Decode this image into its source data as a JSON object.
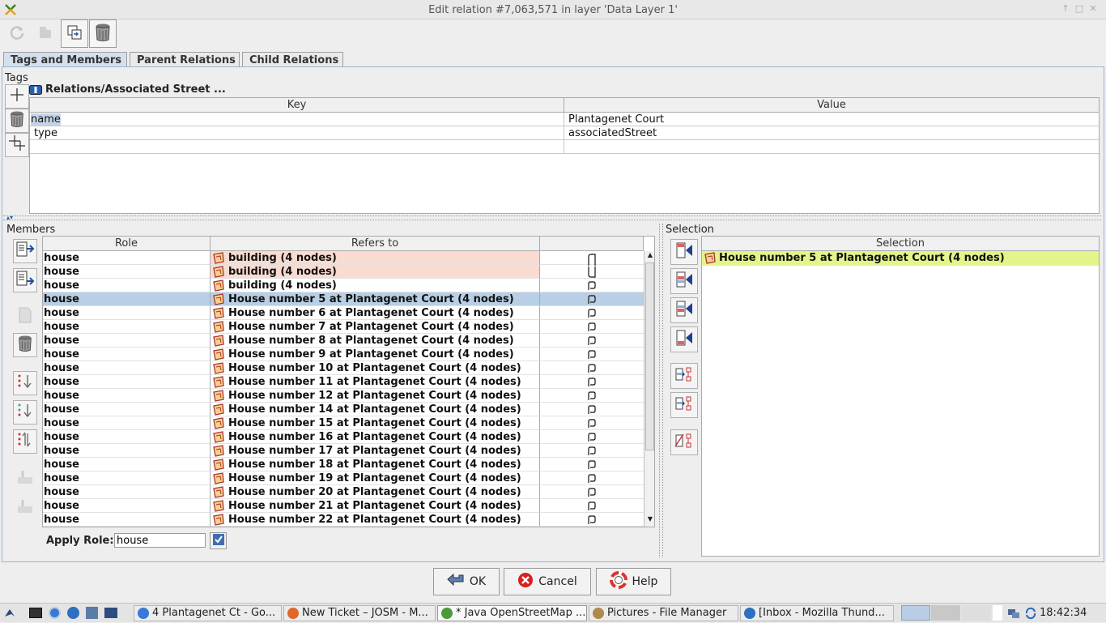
{
  "window": {
    "title": "Edit relation #7,063,571 in layer 'Data Layer 1'"
  },
  "toolbar": {
    "buttons": [
      "refresh-icon",
      "apply-icon",
      "duplicate-icon",
      "delete-icon"
    ]
  },
  "tabs": [
    {
      "label": "Tags and Members",
      "selected": true
    },
    {
      "label": "Parent Relations",
      "selected": false
    },
    {
      "label": "Child Relations",
      "selected": false
    }
  ],
  "tags": {
    "section_label": "Tags",
    "preset_label": "Relations/Associated Street ...",
    "columns": [
      "Key",
      "Value"
    ],
    "rows": [
      {
        "key": "name",
        "value": "Plantagenet Court"
      },
      {
        "key": "type",
        "value": "associatedStreet"
      }
    ]
  },
  "members": {
    "section_label": "Members",
    "columns": [
      "Role",
      "Refers to",
      ""
    ],
    "rows": [
      {
        "role": "house",
        "refers_to": "building (4 nodes)",
        "state": "warn"
      },
      {
        "role": "house",
        "refers_to": "building (4 nodes)",
        "state": "warn"
      },
      {
        "role": "house",
        "refers_to": "building (4 nodes)",
        "state": ""
      },
      {
        "role": "house",
        "refers_to": "House number 5 at Plantagenet Court (4 nodes)",
        "state": "selected"
      },
      {
        "role": "house",
        "refers_to": "House number 6 at Plantagenet Court (4 nodes)",
        "state": ""
      },
      {
        "role": "house",
        "refers_to": "House number 7 at Plantagenet Court (4 nodes)",
        "state": ""
      },
      {
        "role": "house",
        "refers_to": "House number 8 at Plantagenet Court (4 nodes)",
        "state": ""
      },
      {
        "role": "house",
        "refers_to": "House number 9 at Plantagenet Court (4 nodes)",
        "state": ""
      },
      {
        "role": "house",
        "refers_to": "House number 10 at Plantagenet Court (4 nodes)",
        "state": ""
      },
      {
        "role": "house",
        "refers_to": "House number 11 at Plantagenet Court (4 nodes)",
        "state": ""
      },
      {
        "role": "house",
        "refers_to": "House number 12 at Plantagenet Court (4 nodes)",
        "state": ""
      },
      {
        "role": "house",
        "refers_to": "House number 14 at Plantagenet Court (4 nodes)",
        "state": ""
      },
      {
        "role": "house",
        "refers_to": "House number 15 at Plantagenet Court (4 nodes)",
        "state": ""
      },
      {
        "role": "house",
        "refers_to": "House number 16 at Plantagenet Court (4 nodes)",
        "state": ""
      },
      {
        "role": "house",
        "refers_to": "House number 17 at Plantagenet Court (4 nodes)",
        "state": ""
      },
      {
        "role": "house",
        "refers_to": "House number 18 at Plantagenet Court (4 nodes)",
        "state": ""
      },
      {
        "role": "house",
        "refers_to": "House number 19 at Plantagenet Court (4 nodes)",
        "state": ""
      },
      {
        "role": "house",
        "refers_to": "House number 20 at Plantagenet Court (4 nodes)",
        "state": ""
      },
      {
        "role": "house",
        "refers_to": "House number 21 at Plantagenet Court (4 nodes)",
        "state": ""
      },
      {
        "role": "house",
        "refers_to": "House number 22 at Plantagenet Court (4 nodes)",
        "state": ""
      }
    ],
    "apply_role_label": "Apply Role:",
    "apply_role_value": "house"
  },
  "selection": {
    "section_label": "Selection",
    "column": "Selection",
    "rows": [
      "House number 5 at Plantagenet Court (4 nodes)"
    ]
  },
  "buttons": {
    "ok": "OK",
    "cancel": "Cancel",
    "help": "Help"
  },
  "taskbar": {
    "tasks": [
      {
        "label": "4 Plantagenet Ct - Go...",
        "icon": "chrome-icon",
        "active": false
      },
      {
        "label": "New Ticket – JOSM - M...",
        "icon": "firefox-icon",
        "active": false
      },
      {
        "label": "* Java OpenStreetMap ...",
        "icon": "josm-icon",
        "active": true
      },
      {
        "label": "Pictures - File Manager",
        "icon": "folder-icon",
        "active": false
      },
      {
        "label": "[Inbox - Mozilla Thund...",
        "icon": "thunderbird-icon",
        "active": false
      }
    ],
    "clock": "18:42:34"
  },
  "colors": {
    "selected_row": "#b8cfe5",
    "warn_row": "#fadbd0",
    "selection_highlight": "#e4f48a",
    "tab_selected": "#d4e0ee"
  }
}
